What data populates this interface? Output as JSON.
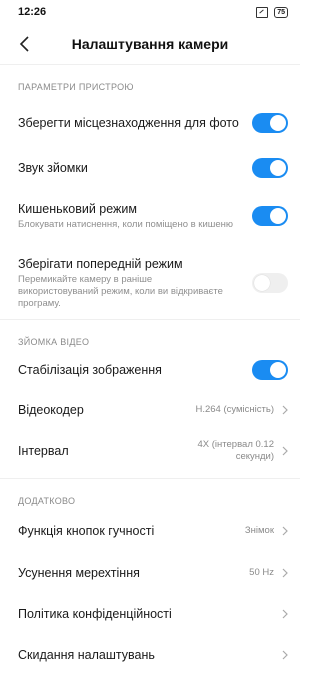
{
  "status_bar": {
    "time": "12:26",
    "battery": "75"
  },
  "header": {
    "title": "Налаштування камери"
  },
  "sections": {
    "device": {
      "title": "ПАРАМЕТРИ ПРИСТРОЮ",
      "items": [
        {
          "label": "Зберегти місцезнаходження для фото",
          "toggle": true
        },
        {
          "label": "Звук зйомки",
          "toggle": true
        },
        {
          "label": "Кишеньковий режим",
          "desc": "Блокувати натиснення, коли поміщено в кишеню",
          "toggle": true
        },
        {
          "label": "Зберігати попередній режим",
          "desc": "Перемикайте камеру в раніше використовуваний режим, коли ви відкриваєте програму.",
          "toggle": false
        }
      ]
    },
    "video": {
      "title": "ЗЙОМКА ВІДЕО",
      "items": [
        {
          "label": "Стабілізація зображення",
          "toggle": true
        },
        {
          "label": "Відеокодер",
          "value": "H.264 (сумісність)"
        },
        {
          "label": "Інтервал",
          "value": "4X (інтервал 0.12 секунди)"
        }
      ]
    },
    "extra": {
      "title": "ДОДАТКОВО",
      "items": [
        {
          "label": "Функція кнопок гучності",
          "value": "Знімок"
        },
        {
          "label": "Усунення мерехтіння",
          "value": "50 Hz"
        },
        {
          "label": "Політика конфіденційності"
        },
        {
          "label": "Скидання налаштувань"
        }
      ]
    }
  },
  "icons": {
    "back": "arrow-back-icon",
    "chevron": "chevron-right-icon"
  },
  "colors": {
    "accent": "#1a8cf2",
    "toggle_off": "#efefef",
    "secondary_text": "#8a8a8a"
  }
}
